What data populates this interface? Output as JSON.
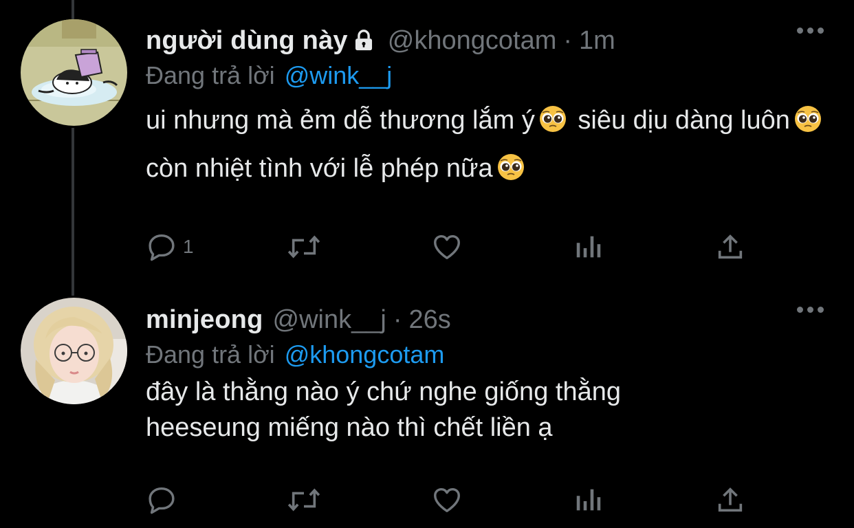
{
  "tweets": [
    {
      "display_name": "người dùng này",
      "locked": true,
      "handle": "@khongcotam",
      "separator": "·",
      "time": "1m",
      "replying_prefix": "Đang trả lời",
      "replying_to": "@wink__j",
      "body_parts": [
        "ui nhưng mà ẻm dễ thương lắm ý",
        " siêu dịu dàng luôn",
        " còn nhiệt tình với lễ phép nữa",
        ""
      ],
      "reply_count": "1",
      "avatar_icon": "kuromi-sticker-avatar"
    },
    {
      "display_name": "minjeong",
      "locked": false,
      "handle": "@wink__j",
      "separator": "·",
      "time": "26s",
      "replying_prefix": "Đang trả lời",
      "replying_to": "@khongcotam",
      "body_line_1": "đây là thằng nào ý chứ nghe giống thằng",
      "body_line_2": "heeseung miếng nào thì chết liền ạ",
      "reply_count": "",
      "avatar_icon": "photo-avatar"
    }
  ],
  "icons": {
    "more": "more-horizontal-icon",
    "reply": "reply-bubble-icon",
    "retweet": "retweet-icon",
    "like": "heart-icon",
    "stats": "analytics-icon",
    "share": "share-icon",
    "emoji": "pleading-face-emoji"
  },
  "colors": {
    "background": "#000000",
    "text": "#e7e9ea",
    "muted": "#71767b",
    "link": "#1d9bf0",
    "thread_line": "#333639"
  }
}
